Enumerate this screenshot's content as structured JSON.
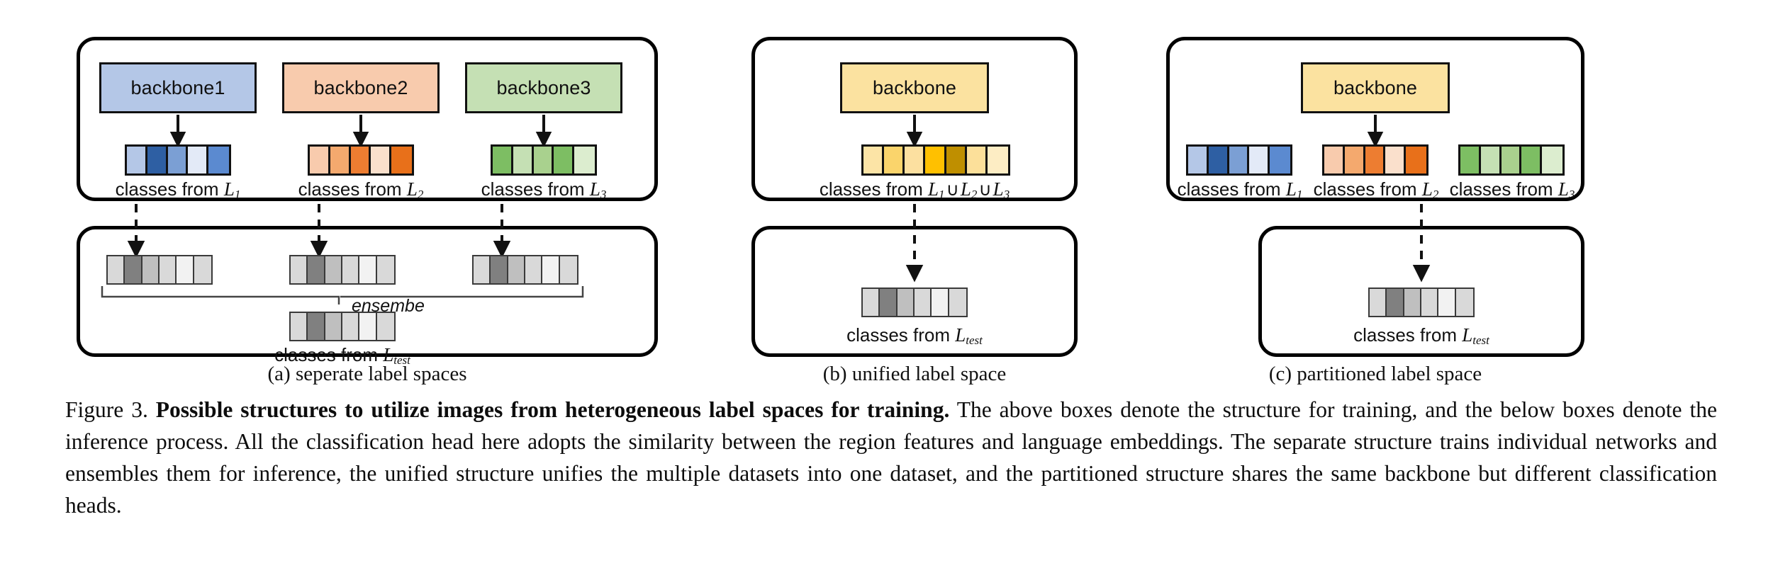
{
  "figure": {
    "panels": [
      {
        "id": "a",
        "subcaption": "(a) seperate label spaces",
        "backbones": [
          {
            "label": "backbone1",
            "color": "#B4C7E7"
          },
          {
            "label": "backbone2",
            "color": "#F8CBAD"
          },
          {
            "label": "backbone3",
            "color": "#C5E0B4"
          }
        ],
        "strips": [
          {
            "name": "blue-strip",
            "cells": [
              "#B4C7E7",
              "#2E5FA3",
              "#7B9FD4",
              "#E3EAF7",
              "#5B8AD0"
            ]
          },
          {
            "name": "orange-strip",
            "cells": [
              "#F8CBAD",
              "#F4A96E",
              "#ED7D31",
              "#FAE0CC",
              "#E8701A"
            ]
          },
          {
            "name": "green-strip",
            "cells": [
              "#7DBE63",
              "#C5E0B4",
              "#A9D18E",
              "#7DBE63",
              "#DCEDCF"
            ]
          }
        ],
        "class_labels": [
          {
            "prefix": "classes from ",
            "symbol": "L",
            "sub": "1"
          },
          {
            "prefix": "classes from ",
            "symbol": "L",
            "sub": "2"
          },
          {
            "prefix": "classes from ",
            "symbol": "L",
            "sub": "3"
          }
        ],
        "inference": {
          "gray_strips": [
            {
              "name": "gray-strip-1",
              "cells": [
                "#D9D9D9",
                "#808080",
                "#BFBFBF",
                "#D9D9D9",
                "#F2F2F2",
                "#D9D9D9"
              ]
            },
            {
              "name": "gray-strip-2",
              "cells": [
                "#D9D9D9",
                "#808080",
                "#BFBFBF",
                "#D9D9D9",
                "#F2F2F2",
                "#D9D9D9"
              ]
            },
            {
              "name": "gray-strip-3",
              "cells": [
                "#D9D9D9",
                "#808080",
                "#BFBFBF",
                "#D9D9D9",
                "#F2F2F2",
                "#D9D9D9"
              ]
            }
          ],
          "ensemble_label": "ensembe",
          "result_strip": {
            "name": "gray-strip-result",
            "cells": [
              "#D9D9D9",
              "#808080",
              "#BFBFBF",
              "#D9D9D9",
              "#F2F2F2",
              "#D9D9D9"
            ]
          },
          "result_label": {
            "prefix": "classes from ",
            "symbol": "L",
            "sub": "test"
          }
        }
      },
      {
        "id": "b",
        "subcaption": "(b) unified label space",
        "backbones": [
          {
            "label": "backbone",
            "color": "#FBE2A0"
          }
        ],
        "strips": [
          {
            "name": "yellow-strip",
            "cells": [
              "#FCE4A6",
              "#FAD46B",
              "#FCE0A0",
              "#FFC000",
              "#BF8F00",
              "#FCE09A",
              "#FDEDC4"
            ]
          }
        ],
        "class_labels": [
          {
            "prefix": "classes from ",
            "symbol": "L",
            "sub": "1",
            "union": [
              "L₂",
              "L₃"
            ]
          }
        ],
        "union_label": {
          "prefix": "classes from ",
          "terms": [
            "1",
            "2",
            "3"
          ],
          "operator": "∪"
        },
        "inference": {
          "gray_strips": [],
          "result_strip": {
            "name": "gray-strip-result",
            "cells": [
              "#D9D9D9",
              "#808080",
              "#BFBFBF",
              "#D9D9D9",
              "#F2F2F2",
              "#D9D9D9"
            ]
          },
          "result_label": {
            "prefix": "classes from ",
            "symbol": "L",
            "sub": "test"
          }
        }
      },
      {
        "id": "c",
        "subcaption": "(c) partitioned label space",
        "backbones": [
          {
            "label": "backbone",
            "color": "#FBE2A0"
          }
        ],
        "strips": [
          {
            "name": "blue-strip",
            "cells": [
              "#B4C7E7",
              "#2E5FA3",
              "#7B9FD4",
              "#E3EAF7",
              "#5B8AD0"
            ]
          },
          {
            "name": "orange-strip",
            "cells": [
              "#F8CBAD",
              "#F4A96E",
              "#ED7D31",
              "#FAE0CC",
              "#E8701A"
            ]
          },
          {
            "name": "green-strip",
            "cells": [
              "#7DBE63",
              "#C5E0B4",
              "#A9D18E",
              "#7DBE63",
              "#DCEDCF"
            ]
          }
        ],
        "class_labels": [
          {
            "prefix": "classes from ",
            "symbol": "L",
            "sub": "1"
          },
          {
            "prefix": "classes from ",
            "symbol": "L",
            "sub": "2"
          },
          {
            "prefix": "classes from ",
            "symbol": "L",
            "sub": "3"
          }
        ],
        "inference": {
          "gray_strips": [],
          "result_strip": {
            "name": "gray-strip-result",
            "cells": [
              "#D9D9D9",
              "#808080",
              "#BFBFBF",
              "#D9D9D9",
              "#F2F2F2",
              "#D9D9D9"
            ]
          },
          "result_label": {
            "prefix": "classes from ",
            "symbol": "L",
            "sub": "test"
          }
        }
      }
    ],
    "caption": {
      "number": "Figure 3.",
      "bold_part": "Possible structures to utilize images from heterogeneous label spaces for training.",
      "body": " The above boxes denote the structure for training, and the below boxes denote the inference process. All the classification head here adopts the similarity between the region features and language embeddings. The separate structure trains individual networks and ensembles them for inference, the unified structure unifies the multiple datasets into one dataset, and the partitioned structure shares the same backbone but different classification heads."
    }
  }
}
